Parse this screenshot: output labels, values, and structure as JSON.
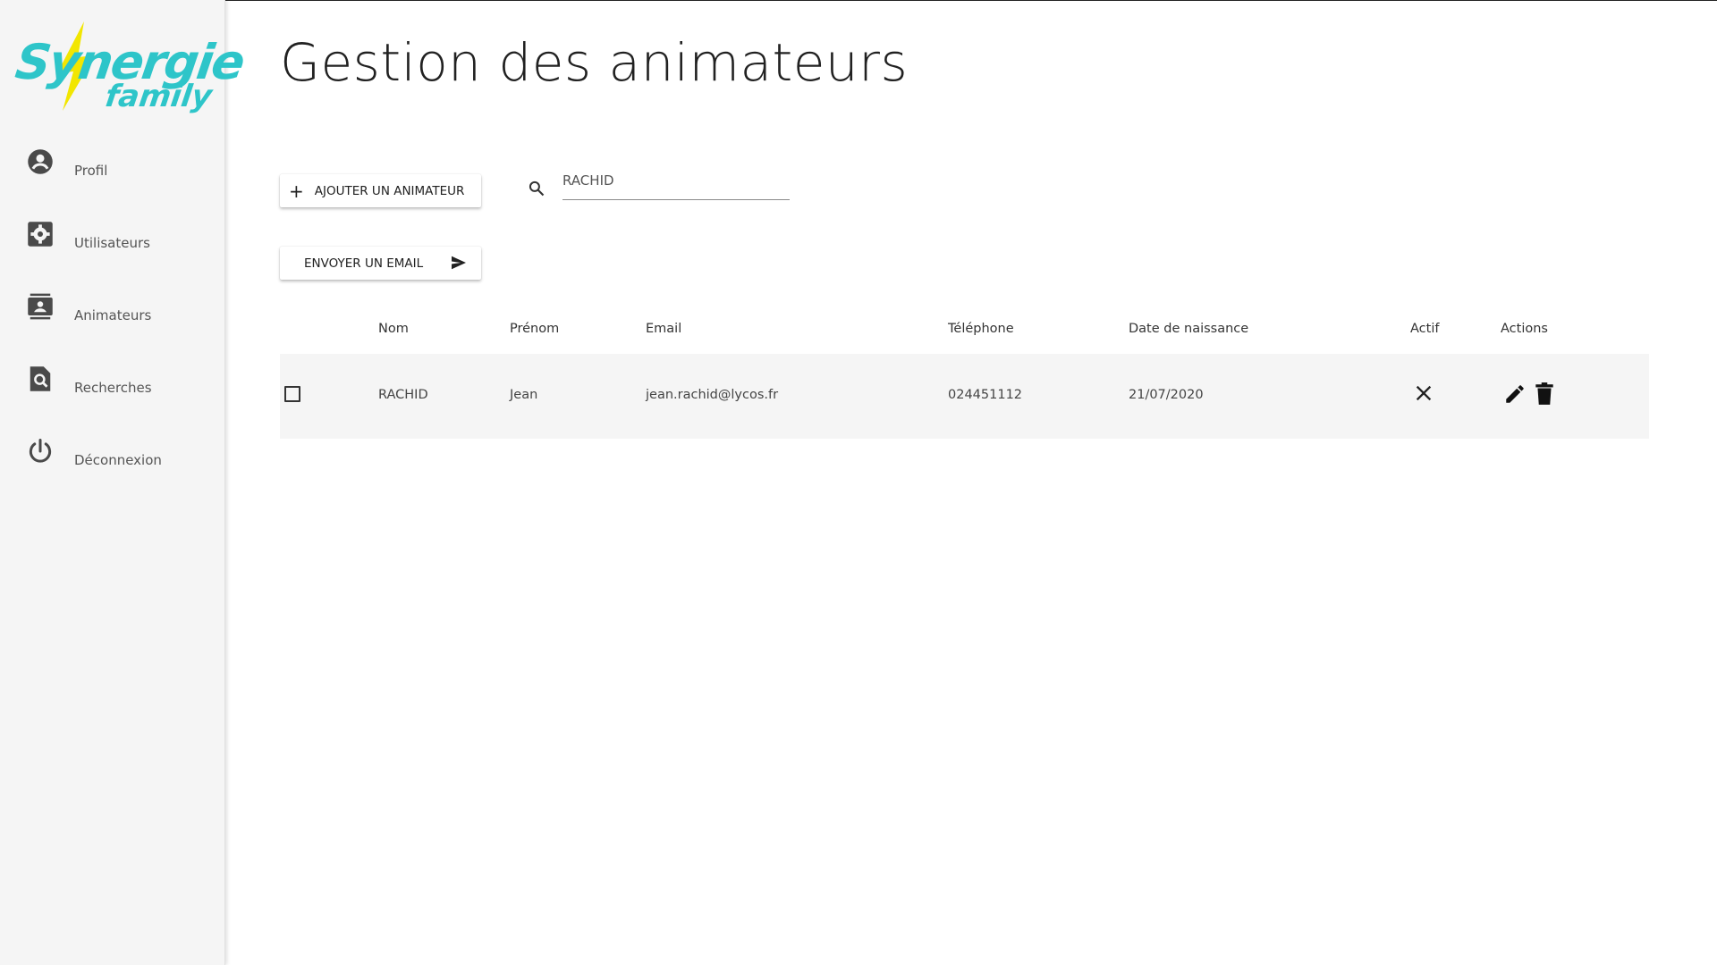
{
  "brand": {
    "line1": "Synergie",
    "line2": "family",
    "color": "#2ec5c9",
    "bolt_color": "#f2e600"
  },
  "sidebar": {
    "items": [
      {
        "label": "Profil",
        "icon": "account-circle-icon"
      },
      {
        "label": "Utilisateurs",
        "icon": "settings-box-icon"
      },
      {
        "label": "Animateurs",
        "icon": "contacts-icon"
      },
      {
        "label": "Recherches",
        "icon": "find-in-page-icon"
      },
      {
        "label": "Déconnexion",
        "icon": "power-icon"
      }
    ]
  },
  "page": {
    "title": "Gestion des animateurs"
  },
  "toolbar": {
    "add_label": "AJOUTER UN ANIMATEUR",
    "email_label": "ENVOYER UN EMAIL",
    "search_value": "RACHID"
  },
  "table": {
    "headers": {
      "nom": "Nom",
      "prenom": "Prénom",
      "email": "Email",
      "telephone": "Téléphone",
      "naissance": "Date de naissance",
      "actif": "Actif",
      "actions": "Actions"
    },
    "rows": [
      {
        "nom": "RACHID",
        "prenom": "Jean",
        "email": "jean.rachid@lycos.fr",
        "telephone": "024451112",
        "naissance": "21/07/2020",
        "actif": false
      }
    ]
  }
}
